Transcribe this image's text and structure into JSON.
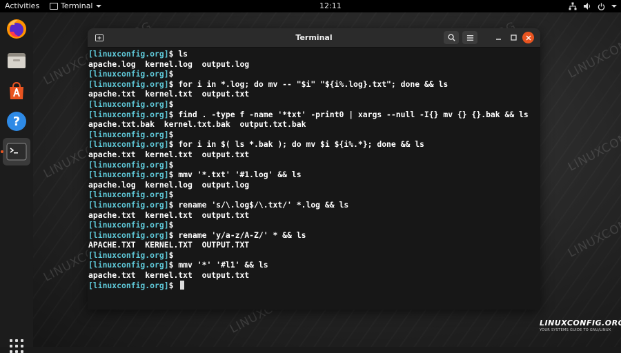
{
  "topbar": {
    "activities": "Activities",
    "app_name": "Terminal",
    "clock": "12:11"
  },
  "dock": {
    "items": [
      "firefox-icon",
      "files-icon",
      "software-icon",
      "help-icon",
      "terminal-icon"
    ]
  },
  "window": {
    "title": "Terminal"
  },
  "terminal": {
    "prompt": "[linuxconfig.org]",
    "lines": [
      {
        "type": "cmd",
        "text": "ls"
      },
      {
        "type": "out",
        "text": "apache.log  kernel.log  output.log"
      },
      {
        "type": "cmd",
        "text": ""
      },
      {
        "type": "cmd",
        "text": "for i in *.log; do mv -- \"$i\" \"${i%.log}.txt\"; done && ls"
      },
      {
        "type": "out",
        "text": "apache.txt  kernel.txt  output.txt"
      },
      {
        "type": "cmd",
        "text": ""
      },
      {
        "type": "cmd",
        "text": "find . -type f -name '*txt' -print0 | xargs --null -I{} mv {} {}.bak && ls"
      },
      {
        "type": "out",
        "text": "apache.txt.bak  kernel.txt.bak  output.txt.bak"
      },
      {
        "type": "cmd",
        "text": ""
      },
      {
        "type": "cmd",
        "text": "for i in $( ls *.bak ); do mv $i ${i%.*}; done && ls"
      },
      {
        "type": "out",
        "text": "apache.txt  kernel.txt  output.txt"
      },
      {
        "type": "cmd",
        "text": ""
      },
      {
        "type": "cmd",
        "text": "mmv '*.txt' '#1.log' && ls"
      },
      {
        "type": "out",
        "text": "apache.log  kernel.log  output.log"
      },
      {
        "type": "cmd",
        "text": ""
      },
      {
        "type": "cmd",
        "text": "rename 's/\\.log$/\\.txt/' *.log && ls"
      },
      {
        "type": "out",
        "text": "apache.txt  kernel.txt  output.txt"
      },
      {
        "type": "cmd",
        "text": ""
      },
      {
        "type": "cmd",
        "text": "rename 'y/a-z/A-Z/' * && ls"
      },
      {
        "type": "out",
        "text": "APACHE.TXT  KERNEL.TXT  OUTPUT.TXT"
      },
      {
        "type": "cmd",
        "text": ""
      },
      {
        "type": "cmd",
        "text": "mmv '*' '#l1' && ls"
      },
      {
        "type": "out",
        "text": "apache.txt  kernel.txt  output.txt"
      },
      {
        "type": "cursor",
        "text": ""
      }
    ]
  },
  "watermark": "LINUXCONFIG.ORG",
  "logo": {
    "main": "LINUXCONFIG.ORG",
    "sub": "YOUR SYSTEMS GUIDE TO GNU/LINUX"
  },
  "colors": {
    "prompt": "#5fc9d9",
    "accent": "#e95420",
    "terminal_bg": "#171717",
    "titlebar_bg": "#2b2b2b"
  }
}
